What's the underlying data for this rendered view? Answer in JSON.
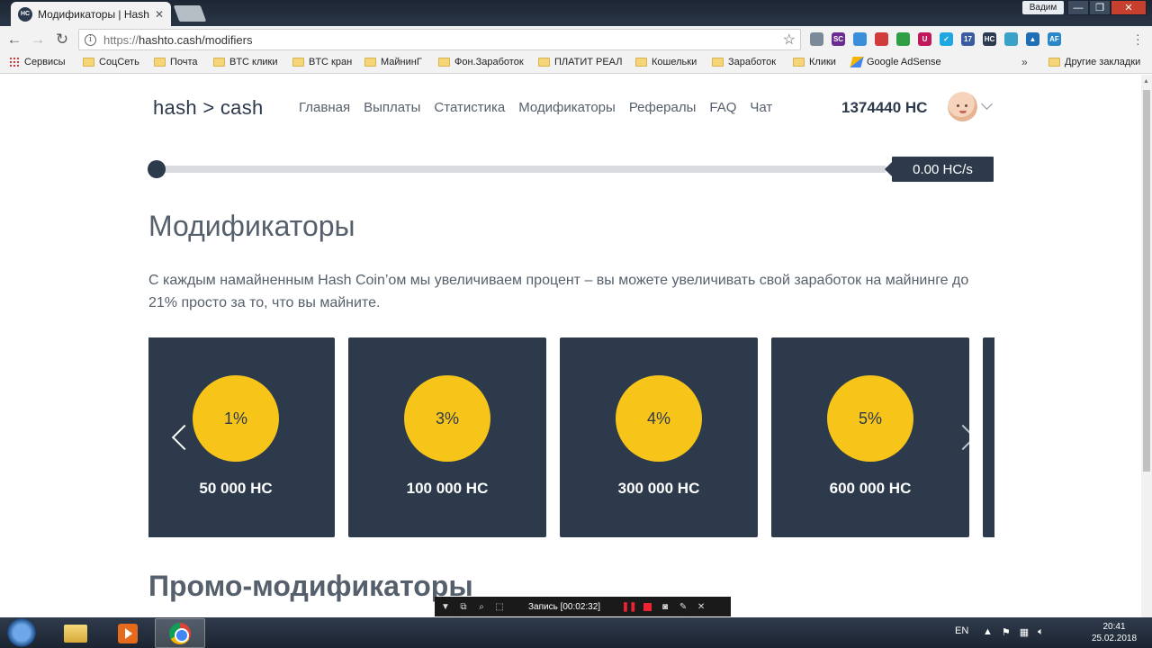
{
  "browser": {
    "tab_title": "Модификаторы | Hash t",
    "favicon_text": "HC",
    "tab_close": "✕",
    "user_badge": "Вадим",
    "window_controls": [
      "—",
      "❐",
      "✕"
    ],
    "url_scheme": "https://",
    "url_host_path": "hashto.cash/modifiers",
    "extension_icons": [
      {
        "name": "grid-ext-icon",
        "color": "#7a8a99",
        "text": ""
      },
      {
        "name": "sc-ext-icon",
        "color": "#6b2c91",
        "text": "SC"
      },
      {
        "name": "swirl-ext-icon",
        "color": "#3b8ed8",
        "text": ""
      },
      {
        "name": "red-dot-ext-icon",
        "color": "#d13b3b",
        "text": ""
      },
      {
        "name": "cube-ext-icon",
        "color": "#2f9e44",
        "text": ""
      },
      {
        "name": "magnet-ext-icon",
        "color": "#c2185b",
        "text": "U"
      },
      {
        "name": "check-ext-icon",
        "color": "#1ea7e1",
        "text": "✓"
      },
      {
        "name": "badge-ext-icon",
        "color": "#3a5ba0",
        "text": "17"
      },
      {
        "name": "hc-ext-icon",
        "color": "#2b3a4f",
        "text": "HC"
      },
      {
        "name": "map-ext-icon",
        "color": "#3aa1c7",
        "text": ""
      },
      {
        "name": "triangle-ext-icon",
        "color": "#1f6fb5",
        "text": "▲"
      },
      {
        "name": "af-ext-icon",
        "color": "#2a88c8",
        "text": "AF"
      }
    ],
    "bookmarks": [
      "Сервисы",
      "СоцСеть",
      "Почта",
      "BTC клики",
      "BTC кран",
      "МайнинГ",
      "Фон.Заработок",
      "ПЛАТИТ РЕАЛ",
      "Кошельки",
      "Заработок",
      "Клики",
      "Google AdSense"
    ],
    "bookmarks_more": "»",
    "other_bookmarks": "Другие закладки"
  },
  "site": {
    "logo": "hash > cash",
    "nav": [
      "Главная",
      "Выплаты",
      "Статистика",
      "Модификаторы",
      "Рефералы",
      "FAQ",
      "Чат"
    ],
    "balance": "1374440 HC",
    "rate": "0.00 HC/s",
    "progress_fraction": 0.0
  },
  "main": {
    "title": "Модификаторы",
    "description": "С каждым намайненным Hash Coin’ом мы увеличиваем процент – вы можете увеличивать свой заработок на майнинге до 21% просто за то, что вы майните.",
    "modifiers": [
      {
        "percent": "1%",
        "amount": "50 000 HC"
      },
      {
        "percent": "3%",
        "amount": "100 000 HC"
      },
      {
        "percent": "4%",
        "amount": "300 000 HC"
      },
      {
        "percent": "5%",
        "amount": "600 000 HC"
      }
    ],
    "promo_title": "Промо-модификаторы"
  },
  "recorder": {
    "label": "Запись [00:02:32]"
  },
  "taskbar": {
    "lang": "EN",
    "time": "20:41",
    "date": "25.02.2018"
  },
  "colors": {
    "accent_dark": "#2c3a4c",
    "coin_yellow": "#f7c41a"
  }
}
